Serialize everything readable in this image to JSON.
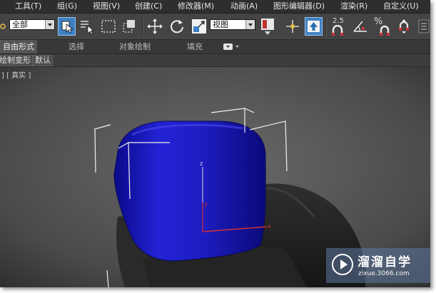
{
  "menu": {
    "items": [
      "工具(T)",
      "组(G)",
      "视图(V)",
      "创建(C)",
      "修改器(M)",
      "动画(A)",
      "图形编辑器(D)",
      "渲染(R)",
      "自定义(U)"
    ]
  },
  "toolbar": {
    "selection_filter": "全部",
    "reference_coord": "视图",
    "angle_snap_value": "2.5",
    "percent_label": "%"
  },
  "ribbon": {
    "tabs": [
      "自由形式",
      "选择",
      "对象绘制",
      "填充"
    ]
  },
  "subbar": {
    "buttons": [
      "绘制变形",
      "默认"
    ]
  },
  "viewport": {
    "label": "] [ 真实 ]",
    "gizmo_axes": [
      "z",
      "y",
      "x"
    ],
    "object_color": "#1c1cbf",
    "chair_color": "#262626"
  },
  "watermark": {
    "title": "溜溜自学",
    "url": "zixue.3066.com"
  },
  "colors": {
    "menubar_bg": "#2e2e2e",
    "toolbar_bg": "#444444",
    "viewport_bg": "#515151",
    "active_tool": "#3e82c6"
  }
}
